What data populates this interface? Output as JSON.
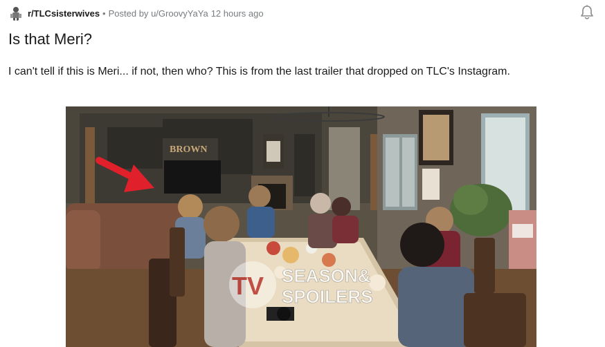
{
  "post": {
    "subreddit": "r/TLCsisterwives",
    "separator": "•",
    "posted_by_label": "Posted by",
    "username": "u/GroovyYaYa",
    "time": "12 hours ago",
    "title": "Is that Meri?",
    "body": "I can't tell if this is Meri... if not, then who? This is from the last trailer that dropped on TLC's Instagram."
  },
  "media": {
    "description_icon": "photo",
    "watermark_line1": "SEASON&",
    "watermark_line2": "SPOILERS",
    "watermark_tv": "TV",
    "wall_sign": "BROWN"
  },
  "icons": {
    "avatar": "subreddit-avatar-icon",
    "notifications": "bell-icon"
  },
  "colors": {
    "text": "#1a1a1b",
    "meta": "#787c7e",
    "arrow": "#e0202a"
  }
}
